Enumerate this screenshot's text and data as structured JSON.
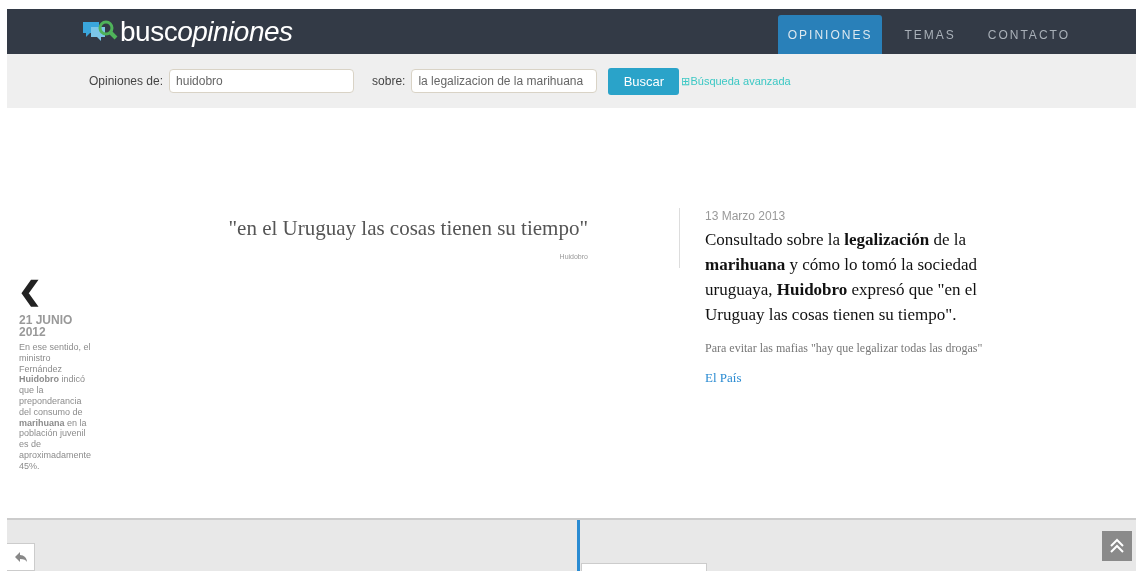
{
  "header": {
    "logo_light": "busc",
    "logo_bold": "opiniones",
    "nav": [
      {
        "label": "OPINIONES",
        "selected": true
      },
      {
        "label": "TEMAS",
        "selected": false
      },
      {
        "label": "CONTACTO",
        "selected": false
      }
    ]
  },
  "search": {
    "author_label": "Opiniones de:",
    "author_value": "huidobro",
    "topic_label": "sobre:",
    "topic_value": "la legalizacion de la marihuana",
    "button": "Buscar",
    "advanced_icon": "⊞",
    "advanced": "Búsqueda avanzada"
  },
  "previous": {
    "arrow": "❮",
    "date": "21 JUNIO 2012",
    "text": "En ese sentido, el ministro Fernández **Huidobro** indicó que la preponderancia del consumo de **marihuana** en la población juvenil es de aproximadamente 45%."
  },
  "quote": {
    "text": "\"en el Uruguay las cosas tienen su tiempo\"",
    "author": "Huidobro"
  },
  "article": {
    "date": "13 Marzo 2013",
    "body": "Consultado sobre la **legalización** de la **marihuana** y cómo lo tomó la sociedad uruguaya, **Huidobro** expresó que \"en el Uruguay las cosas tienen su tiempo\".",
    "headline": "Para evitar las mafias \"hay que legalizar todas las drogas\"",
    "source": "El País"
  }
}
